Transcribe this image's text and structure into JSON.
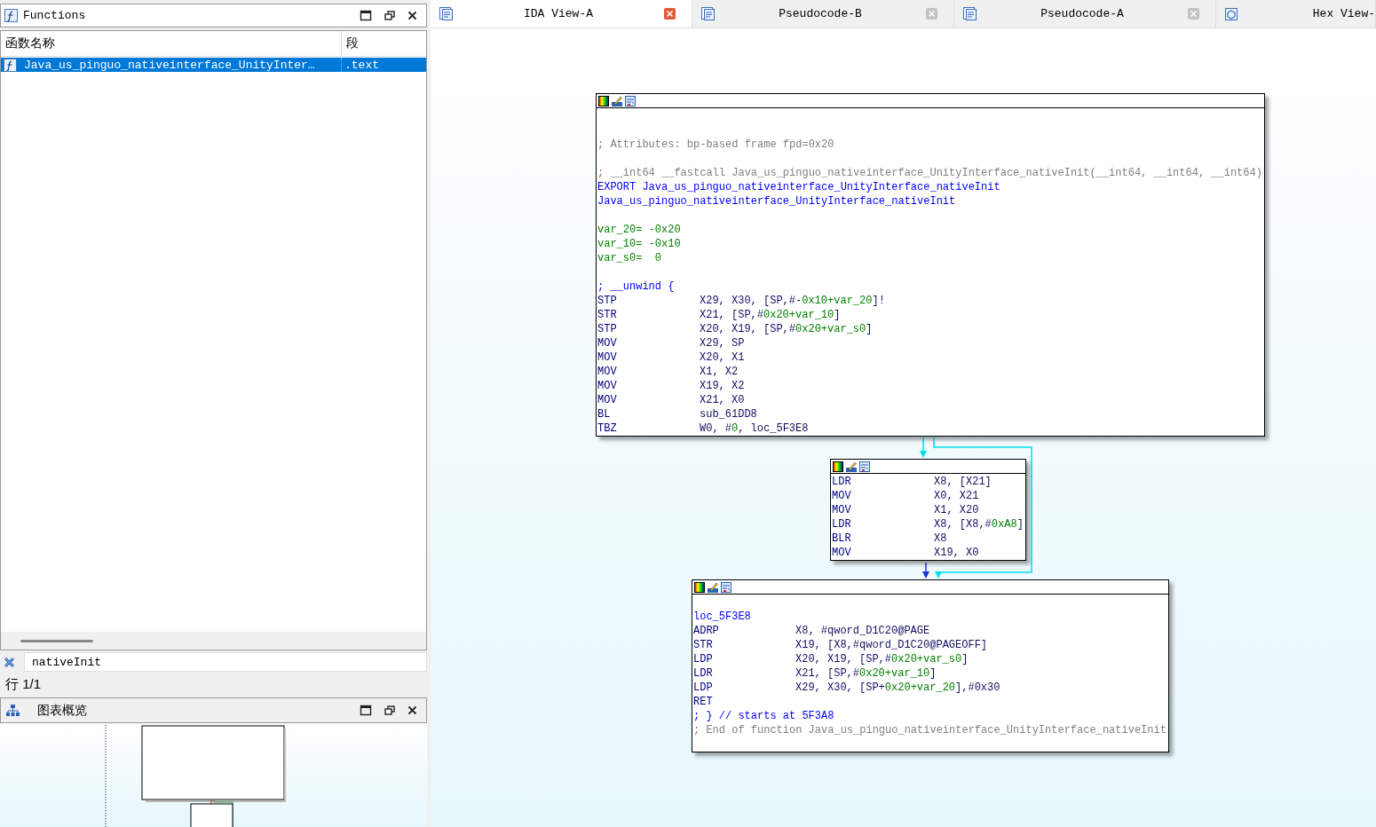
{
  "functions_panel": {
    "title": "Functions",
    "columns": [
      "函数名称",
      "段"
    ],
    "rows": [
      {
        "name": "Java_us_pinguo_nativeinterface_UnityInter…",
        "segment": ".text",
        "selected": true
      }
    ]
  },
  "filter": {
    "value": "nativeInit"
  },
  "status": "行 1/1",
  "overview_panel": {
    "title": "图表概览"
  },
  "tabs": [
    {
      "label": "IDA View-A",
      "kind": "disasm",
      "selected": true,
      "closable": true
    },
    {
      "label": "Pseudocode-B",
      "kind": "pseudocode",
      "selected": false,
      "closable": true
    },
    {
      "label": "Pseudocode-A",
      "kind": "pseudocode",
      "selected": false,
      "closable": true
    },
    {
      "label": "Hex View-",
      "kind": "hex",
      "selected": false,
      "closable": false
    }
  ],
  "graph": {
    "nodes": [
      {
        "lines": [
          {
            "kind": "blank"
          },
          {
            "kind": "blank"
          },
          {
            "kind": "comment",
            "text": "; Attributes: bp-based frame fpd=0x20"
          },
          {
            "kind": "blank"
          },
          {
            "kind": "comment",
            "text": "; __int64 __fastcall Java_us_pinguo_nativeinterface_UnityInterface_nativeInit(__int64, __int64, __int64)"
          },
          {
            "kind": "label",
            "text": "EXPORT Java_us_pinguo_nativeinterface_UnityInterface_nativeInit"
          },
          {
            "kind": "label",
            "text": "Java_us_pinguo_nativeinterface_UnityInterface_nativeInit"
          },
          {
            "kind": "blank"
          },
          {
            "kind": "var",
            "text": "var_20= -0x20"
          },
          {
            "kind": "var",
            "text": "var_10= -0x10"
          },
          {
            "kind": "var",
            "text": "var_s0=  0"
          },
          {
            "kind": "blank"
          },
          {
            "kind": "label",
            "text": "; __unwind {"
          },
          {
            "kind": "instr",
            "op": "STP",
            "args": [
              "X29, X30, [SP,#-",
              "0x10+var_20",
              "]!"
            ]
          },
          {
            "kind": "instr",
            "op": "STR",
            "args": [
              "X21, [SP,#",
              "0x20+var_10",
              "]"
            ]
          },
          {
            "kind": "instr",
            "op": "STP",
            "args": [
              "X20, X19, [SP,#",
              "0x20+var_s0",
              "]"
            ]
          },
          {
            "kind": "instr",
            "op": "MOV",
            "args": [
              "X29, SP"
            ]
          },
          {
            "kind": "instr",
            "op": "MOV",
            "args": [
              "X20, X1"
            ]
          },
          {
            "kind": "instr",
            "op": "MOV",
            "args": [
              "X1, X2"
            ]
          },
          {
            "kind": "instr",
            "op": "MOV",
            "args": [
              "X19, X2"
            ]
          },
          {
            "kind": "instr",
            "op": "MOV",
            "args": [
              "X21, X0"
            ]
          },
          {
            "kind": "instr",
            "op": "BL",
            "args": [
              "sub_61DD8"
            ]
          },
          {
            "kind": "instr",
            "op": "TBZ",
            "args": [
              "W0, #",
              "0",
              ", loc_5F3E8"
            ]
          }
        ]
      },
      {
        "lines": [
          {
            "kind": "instr",
            "op": "LDR",
            "args": [
              "X8, [X21]"
            ]
          },
          {
            "kind": "instr",
            "op": "MOV",
            "args": [
              "X0, X21"
            ]
          },
          {
            "kind": "instr",
            "op": "MOV",
            "args": [
              "X1, X20"
            ]
          },
          {
            "kind": "instr",
            "op": "LDR",
            "args": [
              "X8, [X8,#",
              "0xA8",
              "]"
            ]
          },
          {
            "kind": "instr",
            "op": "BLR",
            "args": [
              "X8"
            ]
          },
          {
            "kind": "instr",
            "op": "MOV",
            "args": [
              "X19, X0"
            ]
          }
        ]
      },
      {
        "lines": [
          {
            "kind": "blank"
          },
          {
            "kind": "label",
            "text": "loc_5F3E8"
          },
          {
            "kind": "instr",
            "op": "ADRP",
            "args": [
              "X8, #qword_D1C20@PAGE"
            ]
          },
          {
            "kind": "instr",
            "op": "STR",
            "args": [
              "X19, [X8,#qword_D1C20@PAGEOFF]"
            ]
          },
          {
            "kind": "instr",
            "op": "LDP",
            "args": [
              "X20, X19, [SP,#",
              "0x20+var_s0",
              "]"
            ]
          },
          {
            "kind": "instr",
            "op": "LDR",
            "args": [
              "X21, [SP,#",
              "0x20+var_10",
              "]"
            ]
          },
          {
            "kind": "instr",
            "op": "LDP",
            "args": [
              "X29, X30, [SP+",
              "0x20+var_20",
              "],#0x30"
            ]
          },
          {
            "kind": "instr",
            "op": "RET"
          },
          {
            "kind": "label",
            "text": "; } // starts at 5F3A8"
          },
          {
            "kind": "comment",
            "text": "; End of function Java_us_pinguo_nativeinterface_UnityInterface_nativeInit"
          },
          {
            "kind": "blank"
          }
        ]
      }
    ],
    "edges": [
      {
        "kind": "flow"
      },
      {
        "kind": "branch"
      },
      {
        "kind": "jump"
      }
    ]
  }
}
